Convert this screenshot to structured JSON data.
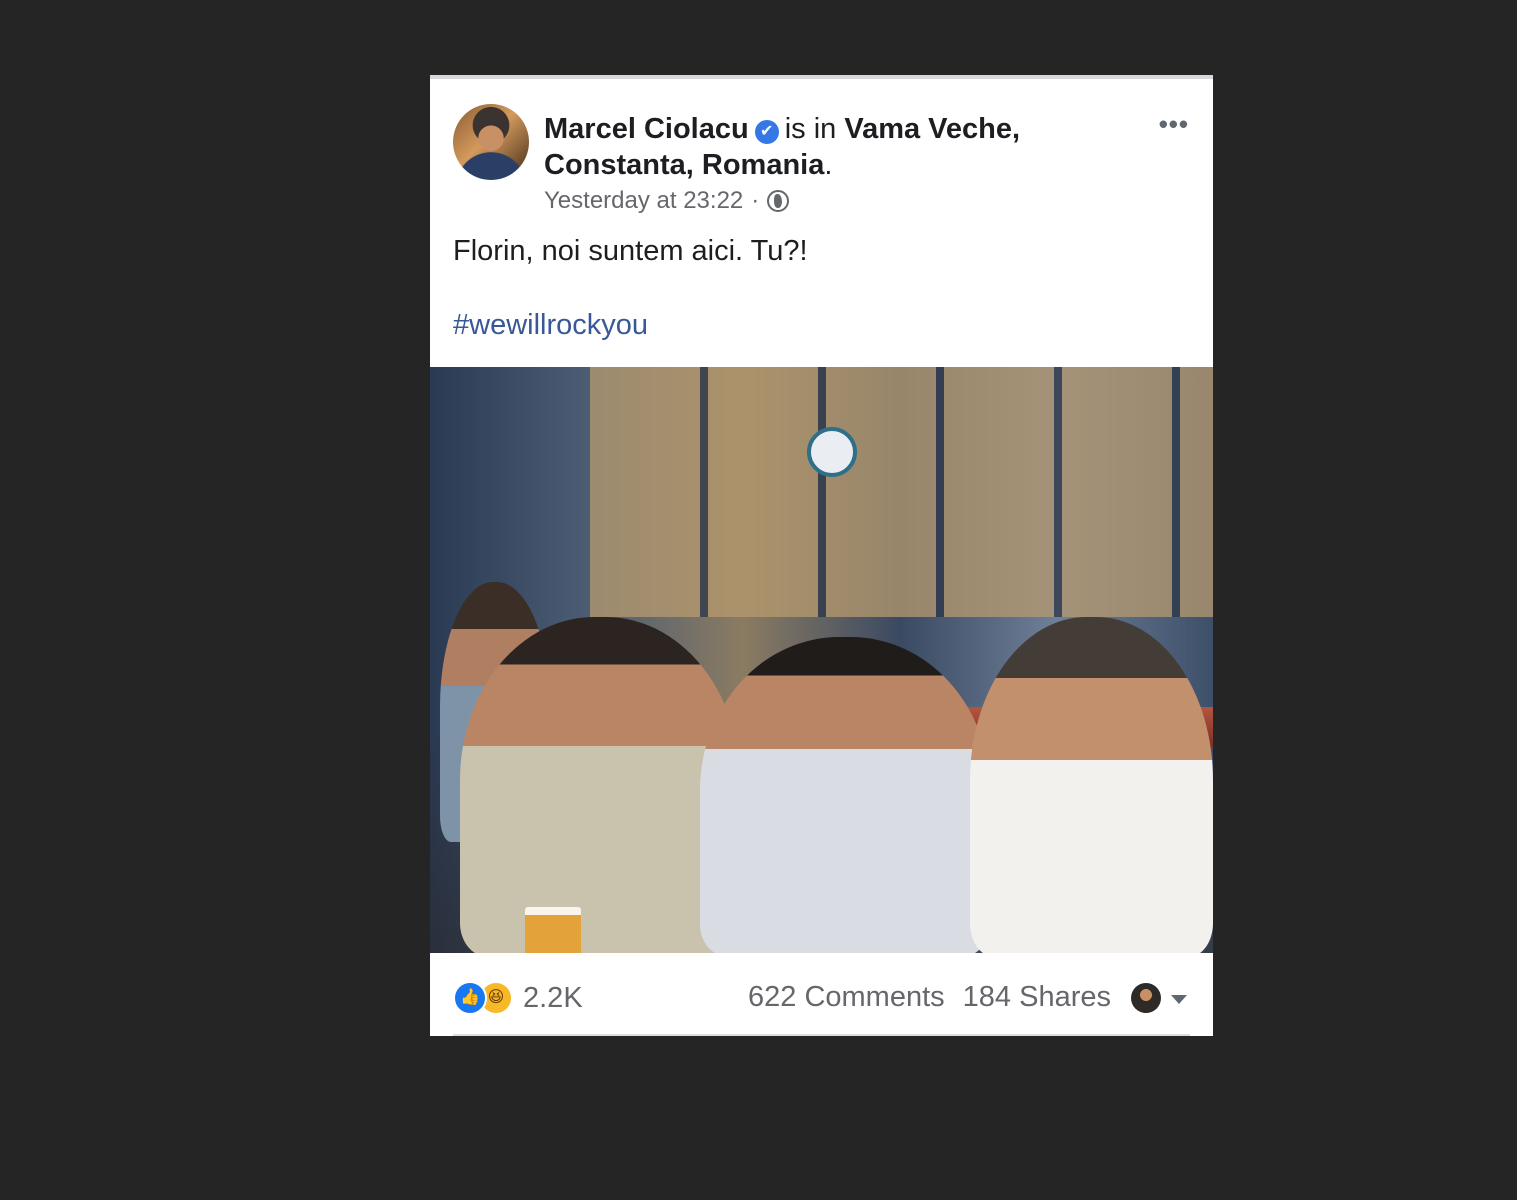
{
  "post": {
    "author": "Marcel Ciolacu",
    "verified_badge": "✔",
    "location_connector": "is in",
    "location_line1": "Vama Veche,",
    "location_line2": "Constanta, Romania",
    "location_period": ".",
    "timestamp": "Yesterday at 23:22",
    "separator": "·",
    "privacy_icon": "globe-icon",
    "more_label": "•••",
    "text": "Florin, noi suntem aici. Tu?!",
    "hashtag": "#wewillrockyou"
  },
  "footer": {
    "reaction_icons": [
      "like-icon",
      "haha-icon"
    ],
    "like_glyph": "👍",
    "haha_glyph": "😆",
    "reaction_count": "2.2K",
    "comments": "622 Comments",
    "shares": "184 Shares"
  },
  "colors": {
    "background": "#252525",
    "link": "#385898",
    "verified": "#3578e5",
    "like": "#1877f2",
    "haha": "#f7b928"
  }
}
